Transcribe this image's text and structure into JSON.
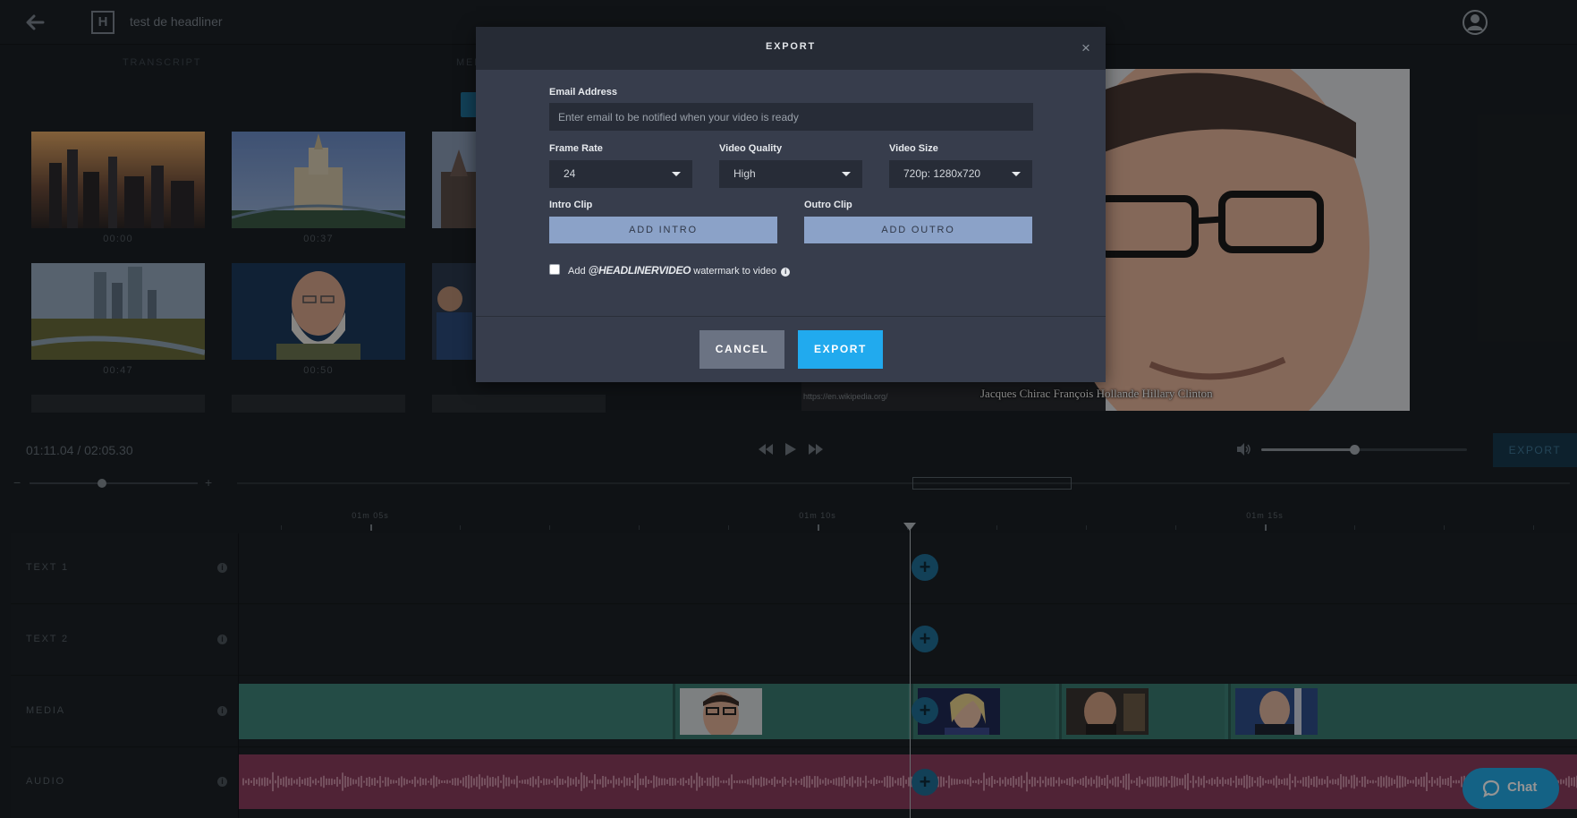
{
  "header": {
    "project_title": "test de headliner",
    "logo_letter": "H"
  },
  "tabs": [
    {
      "label": "TRANSCRIPT"
    },
    {
      "label": "MEDIA"
    }
  ],
  "media_grid": [
    {
      "time": "00:00",
      "thumb": "city-sunset"
    },
    {
      "time": "00:37",
      "thumb": "stalinist-tower"
    },
    {
      "time": "",
      "thumb": "cathedral"
    },
    {
      "time": "00:47",
      "thumb": "city-river"
    },
    {
      "time": "00:50",
      "thumb": "bearded-man"
    },
    {
      "time": "",
      "thumb": "crowd"
    }
  ],
  "preview": {
    "caption": "Jacques Chirac François Hollande Hillary Clinton",
    "credit": "https://en.wikipedia.org/"
  },
  "transport": {
    "timecode": "01:11.04 / 02:05.30",
    "volume": 0.45,
    "export_label": "EXPORT"
  },
  "zoom": {
    "minus": "−",
    "plus": "+",
    "level": 0.43
  },
  "ruler": {
    "labels": [
      "01m 05s",
      "01m 10s",
      "01m 15s"
    ]
  },
  "tracks": [
    {
      "label": "TEXT 1"
    },
    {
      "label": "TEXT 2"
    },
    {
      "label": "MEDIA"
    },
    {
      "label": "AUDIO"
    }
  ],
  "chat": {
    "label": "Chat"
  },
  "modal": {
    "title": "EXPORT",
    "close": "×",
    "email_label": "Email Address",
    "email_placeholder": "Enter email to be notified when your video is ready",
    "email_value": "",
    "frame_rate_label": "Frame Rate",
    "frame_rate_value": "24",
    "quality_label": "Video Quality",
    "quality_value": "High",
    "size_label": "Video Size",
    "size_value": "720p: 1280x720",
    "intro_label": "Intro Clip",
    "intro_button": "ADD INTRO",
    "outro_label": "Outro Clip",
    "outro_button": "ADD OUTRO",
    "watermark_prefix": "Add",
    "watermark_brand": "@HEADLINERVIDEO",
    "watermark_suffix": "watermark to video",
    "watermark_checked": false,
    "cancel_label": "CANCEL",
    "export_label": "EXPORT"
  },
  "colors": {
    "accent": "#21aaee",
    "media_track": "#3e8379",
    "audio_track": "#8b3d5e",
    "intro_outro_button": "#8ba2c8"
  }
}
